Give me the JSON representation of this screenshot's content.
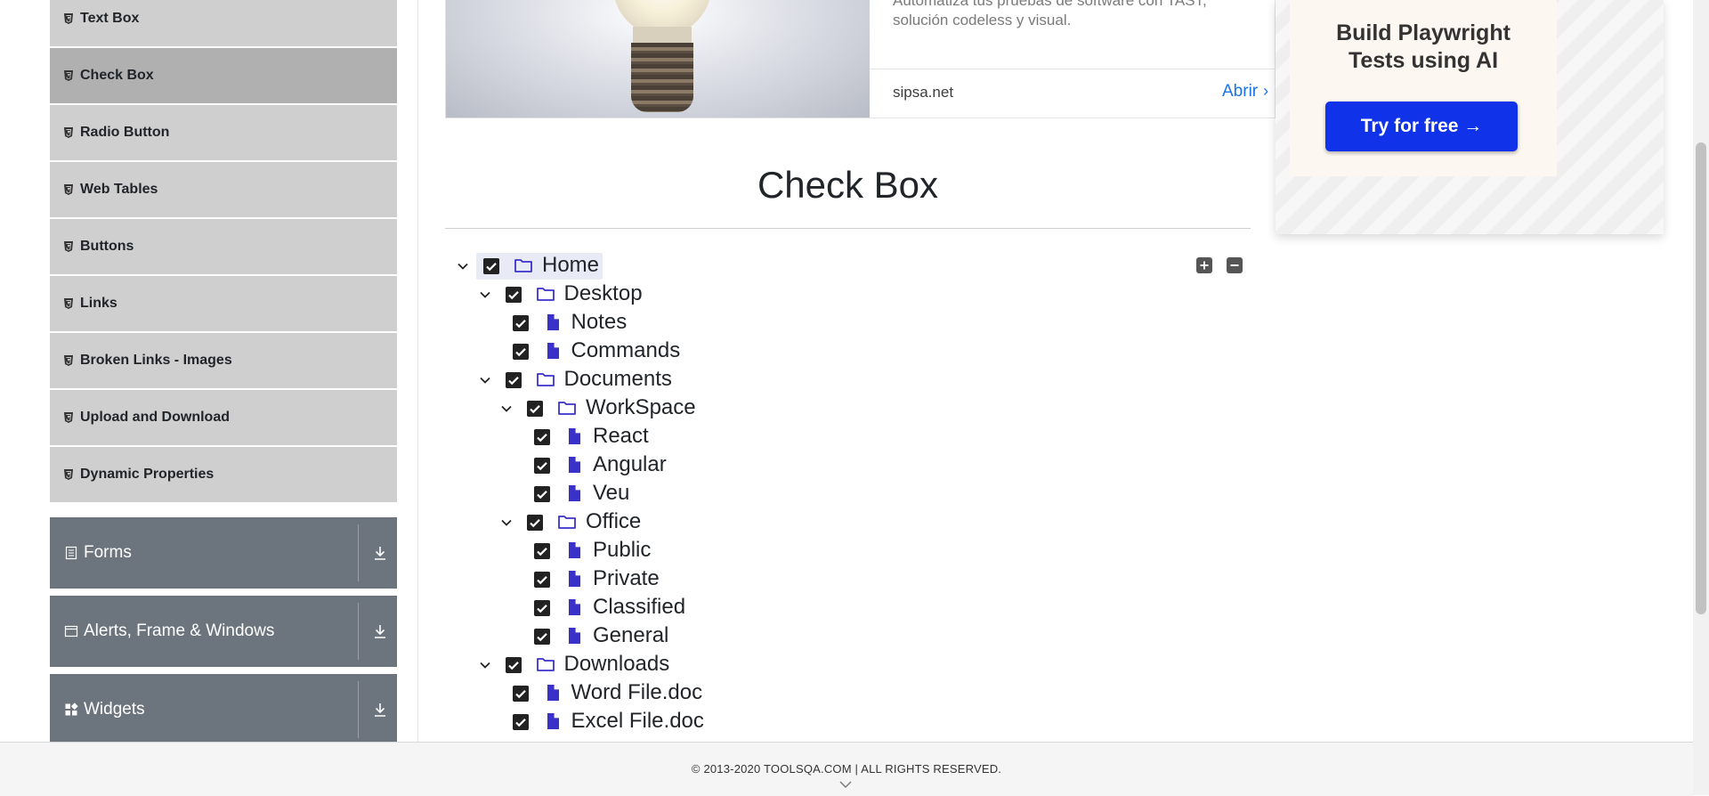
{
  "sidebar": {
    "items": [
      {
        "label": "Text Box",
        "active": false
      },
      {
        "label": "Check Box",
        "active": true
      },
      {
        "label": "Radio Button",
        "active": false
      },
      {
        "label": "Web Tables",
        "active": false
      },
      {
        "label": "Buttons",
        "active": false
      },
      {
        "label": "Links",
        "active": false
      },
      {
        "label": "Broken Links - Images",
        "active": false
      },
      {
        "label": "Upload and Download",
        "active": false
      },
      {
        "label": "Dynamic Properties",
        "active": false
      }
    ],
    "groups": [
      {
        "label": "Forms",
        "icon": "form-icon"
      },
      {
        "label": "Alerts, Frame & Windows",
        "icon": "window-icon"
      },
      {
        "label": "Widgets",
        "icon": "widgets-icon"
      }
    ]
  },
  "ad": {
    "description": "Automatiza tus pruebas de software con TAST, solución codeless y visual.",
    "domain": "sipsa.net",
    "open_label": "Abrir"
  },
  "promo": {
    "title_line1": "Build Playwright",
    "title_line2": "Tests using AI",
    "button_label": "Try for free →"
  },
  "page": {
    "title": "Check Box"
  },
  "tree": [
    {
      "label": "Home",
      "type": "folder",
      "checked": true,
      "expanded": true,
      "level": 0,
      "selected": true
    },
    {
      "label": "Desktop",
      "type": "folder",
      "checked": true,
      "expanded": true,
      "level": 1
    },
    {
      "label": "Notes",
      "type": "file",
      "checked": true,
      "level": 2
    },
    {
      "label": "Commands",
      "type": "file",
      "checked": true,
      "level": 2
    },
    {
      "label": "Documents",
      "type": "folder",
      "checked": true,
      "expanded": true,
      "level": 1
    },
    {
      "label": "WorkSpace",
      "type": "folder",
      "checked": true,
      "expanded": true,
      "level": 2
    },
    {
      "label": "React",
      "type": "file",
      "checked": true,
      "level": 3
    },
    {
      "label": "Angular",
      "type": "file",
      "checked": true,
      "level": 3
    },
    {
      "label": "Veu",
      "type": "file",
      "checked": true,
      "level": 3
    },
    {
      "label": "Office",
      "type": "folder",
      "checked": true,
      "expanded": true,
      "level": 2
    },
    {
      "label": "Public",
      "type": "file",
      "checked": true,
      "level": 3
    },
    {
      "label": "Private",
      "type": "file",
      "checked": true,
      "level": 3
    },
    {
      "label": "Classified",
      "type": "file",
      "checked": true,
      "level": 3
    },
    {
      "label": "General",
      "type": "file",
      "checked": true,
      "level": 3
    },
    {
      "label": "Downloads",
      "type": "folder",
      "checked": true,
      "expanded": true,
      "level": 1
    },
    {
      "label": "Word File.doc",
      "type": "file",
      "checked": true,
      "level": 2
    },
    {
      "label": "Excel File.doc",
      "type": "file",
      "checked": true,
      "level": 2
    }
  ],
  "footer": {
    "text": "© 2013-2020 TOOLSQA.COM | ALL RIGHTS RESERVED."
  },
  "colors": {
    "sidebar_item": "#cfcfcf",
    "sidebar_item_active": "#b0b0b0",
    "group_header": "#6c757d",
    "tree_icon": "#3a31c9",
    "checkbox": "#222222",
    "promo_button": "#1032e8",
    "link": "#1a73e8"
  }
}
